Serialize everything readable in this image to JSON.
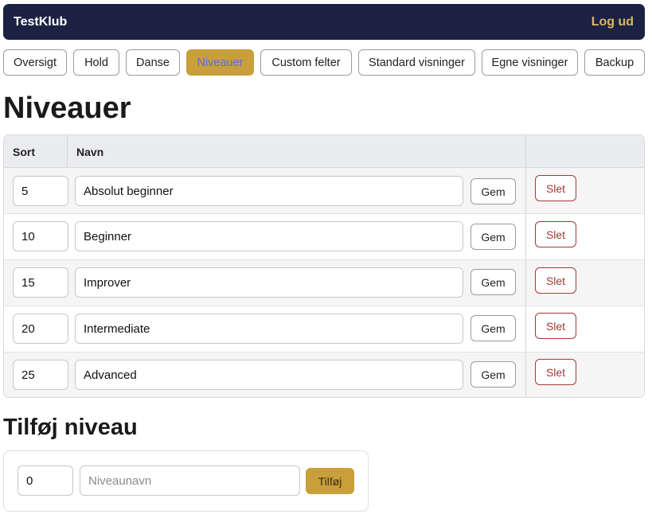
{
  "header": {
    "brand": "TestKlub",
    "logout": "Log ud"
  },
  "nav": {
    "items": [
      {
        "label": "Oversigt"
      },
      {
        "label": "Hold"
      },
      {
        "label": "Danse"
      },
      {
        "label": "Niveauer",
        "active": true
      },
      {
        "label": "Custom felter"
      },
      {
        "label": "Standard visninger"
      },
      {
        "label": "Egne visninger"
      },
      {
        "label": "Backup"
      }
    ]
  },
  "page": {
    "title": "Niveauer"
  },
  "table": {
    "columns": [
      "Sort",
      "Navn",
      ""
    ],
    "rows": [
      {
        "sort": "5",
        "name": "Absolut beginner",
        "save": "Gem",
        "delete": "Slet"
      },
      {
        "sort": "10",
        "name": "Beginner",
        "save": "Gem",
        "delete": "Slet"
      },
      {
        "sort": "15",
        "name": "Improver",
        "save": "Gem",
        "delete": "Slet"
      },
      {
        "sort": "20",
        "name": "Intermediate",
        "save": "Gem",
        "delete": "Slet"
      },
      {
        "sort": "25",
        "name": "Advanced",
        "save": "Gem",
        "delete": "Slet"
      }
    ]
  },
  "add": {
    "title": "Tilføj niveau",
    "sort_value": "0",
    "name_placeholder": "Niveaunavn",
    "button": "Tilføj"
  },
  "colors": {
    "topbar": "#1b2244",
    "accent": "#c89f3a",
    "danger": "#a23a32",
    "logout": "#d9b863"
  }
}
